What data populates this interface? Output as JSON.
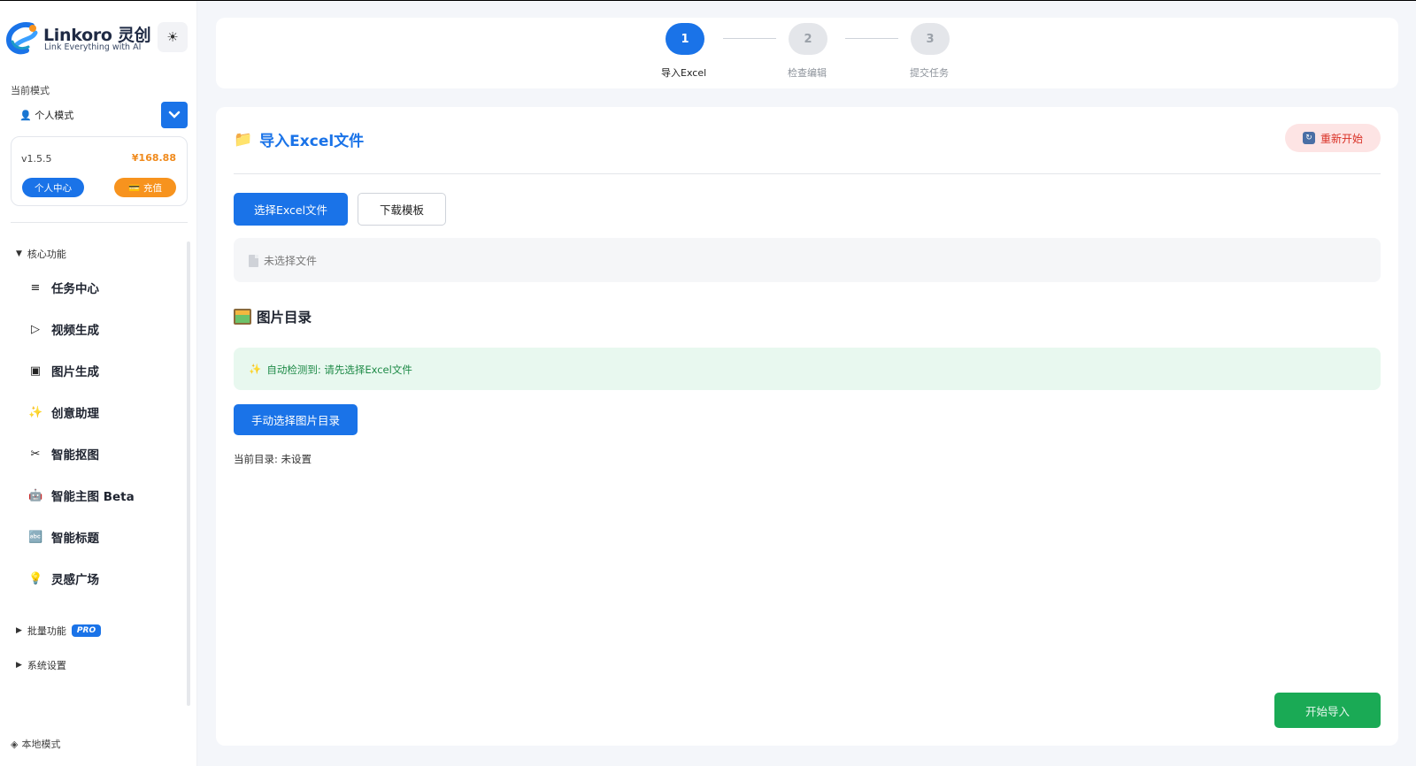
{
  "brand": {
    "name": "Linkoro 灵创",
    "tagline": "Link Everything with AI"
  },
  "theme_toggle_icon": "sun-icon",
  "mode": {
    "label": "当前模式",
    "selected": "👤 个人模式"
  },
  "account": {
    "version": "v1.5.5",
    "balance": "¥168.88",
    "profile_label": "个人中心",
    "recharge_label": "充值"
  },
  "nav": {
    "core_group": "核心功能",
    "items": [
      {
        "icon": "≡",
        "label": "任务中心"
      },
      {
        "icon": "▷",
        "label": "视频生成"
      },
      {
        "icon": "▣",
        "label": "图片生成"
      },
      {
        "icon": "✨",
        "label": "创意助理"
      },
      {
        "icon": "✂",
        "label": "智能抠图"
      },
      {
        "icon": "🤖",
        "label": "智能主图 Beta"
      },
      {
        "icon": "🔤",
        "label": "智能标题"
      },
      {
        "icon": "💡",
        "label": "灵感广场"
      }
    ],
    "batch_group": "批量功能",
    "batch_badge": "PRO",
    "settings_group": "系统设置",
    "local_mode": "本地模式"
  },
  "steps": [
    {
      "number": "1",
      "label": "导入Excel",
      "state": "active"
    },
    {
      "number": "2",
      "label": "检查编辑",
      "state": "idle"
    },
    {
      "number": "3",
      "label": "提交任务",
      "state": "idle"
    }
  ],
  "main": {
    "title": "导入Excel文件",
    "restart_label": "重新开始",
    "select_excel_label": "选择Excel文件",
    "download_template_label": "下载模板",
    "file_status": "未选择文件",
    "image_dir_title": "图片目录",
    "auto_detect_text": "自动检测到: 请先选择Excel文件",
    "manual_select_label": "手动选择图片目录",
    "current_dir_text": "当前目录: 未设置",
    "start_import_label": "开始导入"
  },
  "colors": {
    "primary": "#1a73e8",
    "accent_orange": "#f7931e",
    "danger": "#d93025",
    "success": "#1aaa55"
  }
}
